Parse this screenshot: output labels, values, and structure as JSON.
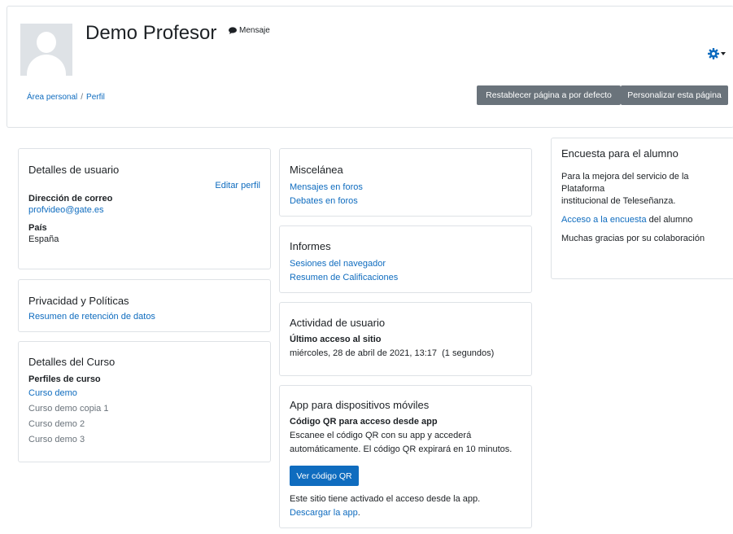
{
  "header": {
    "name": "Demo Profesor",
    "message_label": "Mensaje",
    "breadcrumb": [
      "Área personal",
      "Perfil"
    ],
    "breadcrumb_separator": "/",
    "reset_button": "Restablecer página a por defecto",
    "customize_button": "Personalizar esta página"
  },
  "user_details": {
    "title": "Detalles de usuario",
    "edit_link": "Editar perfil",
    "email_label": "Dirección de correo",
    "email": "profvideo@gate.es",
    "country_label": "País",
    "country": "España"
  },
  "privacy": {
    "title": "Privacidad y Políticas",
    "link": "Resumen de retención de datos"
  },
  "course_details": {
    "title": "Detalles del Curso",
    "subtitle": "Perfiles de curso",
    "courses": [
      "Curso demo",
      "Curso demo copia 1",
      "Curso demo 2",
      "Curso demo 3"
    ]
  },
  "misc": {
    "title": "Miscelánea",
    "links": [
      "Mensajes en foros",
      "Debates en foros"
    ]
  },
  "reports": {
    "title": "Informes",
    "links": [
      "Sesiones del navegador",
      "Resumen de Calificaciones"
    ]
  },
  "activity": {
    "title": "Actividad de usuario",
    "last_access_label": "Último acceso al sitio",
    "last_access_value": "miércoles, 28 de abril de 2021, 13:17  (1 segundos)"
  },
  "mobile": {
    "title": "App para dispositivos móviles",
    "qr_label": "Código QR para acceso desde app",
    "qr_text_1": "Escanee el código QR con su app y accederá",
    "qr_text_2": "automáticamente. El código QR expirará en 10 minutos.",
    "qr_button": "Ver código QR",
    "app_text": "Este sitio tiene activado el acceso desde la app.",
    "download_link": "Descargar la app",
    "download_suffix": "."
  },
  "survey": {
    "title": "Encuesta para el alumno",
    "text_1": "Para la mejora del servicio de la Plataforma",
    "text_2": "institucional de Teleseñanza.",
    "access_link": "Acceso a la encuesta",
    "access_suffix": " del alumno",
    "thanks": "Muchas gracias por su colaboración"
  },
  "colors": {
    "link": "#0f6cbf",
    "button_secondary": "#6a737b",
    "button_primary": "#0f6cbf"
  }
}
